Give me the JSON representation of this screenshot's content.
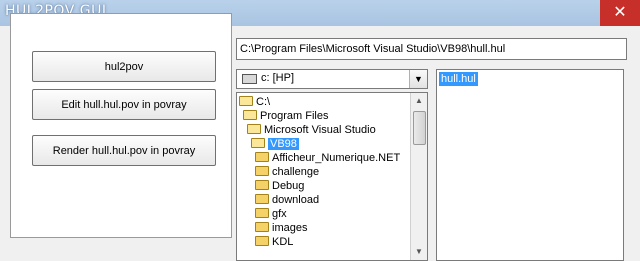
{
  "window": {
    "title": "HUL2POV GUI",
    "close_symbol": "✕"
  },
  "buttons": {
    "hul2pov": "hul2pov",
    "edit": "Edit hull.hul.pov in povray",
    "render": "Render hull.hul.pov in povray"
  },
  "path": {
    "value": "C:\\Program Files\\Microsoft Visual Studio\\VB98\\hull.hul"
  },
  "drive": {
    "selected": "c: [HP]",
    "arrow_symbol": "▼"
  },
  "directories": [
    {
      "label": "C:\\",
      "selected": false
    },
    {
      "label": "Program Files",
      "selected": false
    },
    {
      "label": "Microsoft Visual Studio",
      "selected": false
    },
    {
      "label": "VB98",
      "selected": true
    },
    {
      "label": "Afficheur_Numerique.NET",
      "selected": false
    },
    {
      "label": "challenge",
      "selected": false
    },
    {
      "label": "Debug",
      "selected": false
    },
    {
      "label": "download",
      "selected": false
    },
    {
      "label": "gfx",
      "selected": false
    },
    {
      "label": "images",
      "selected": false
    },
    {
      "label": "KDL",
      "selected": false
    }
  ],
  "files": [
    {
      "label": "hull.hul",
      "selected": true
    }
  ],
  "scrollbar": {
    "up_symbol": "▲",
    "down_symbol": "▼"
  },
  "colors": {
    "selection": "#3399ff",
    "close_button": "#c7302a"
  }
}
